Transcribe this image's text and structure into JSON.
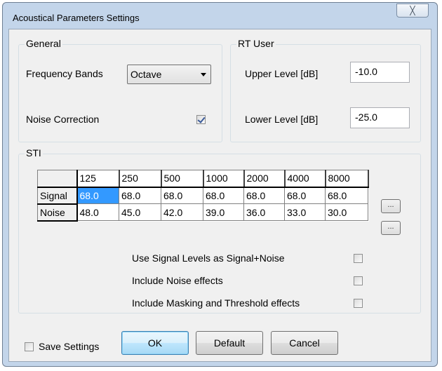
{
  "window": {
    "title": "Acoustical Parameters Settings",
    "close_glyph": "╳"
  },
  "general": {
    "title": "General",
    "frequency_bands_label": "Frequency Bands",
    "frequency_bands_value": "Octave",
    "noise_correction_label": "Noise Correction",
    "noise_correction_checked": true
  },
  "rt_user": {
    "title": "RT User",
    "upper_label": "Upper Level [dB]",
    "upper_value": "-10.0",
    "lower_label": "Lower Level [dB]",
    "lower_value": "-25.0"
  },
  "sti": {
    "title": "STI",
    "columns": [
      "125",
      "250",
      "500",
      "1000",
      "2000",
      "4000",
      "8000"
    ],
    "rows": [
      {
        "label": "Signal",
        "values": [
          "68.0",
          "68.0",
          "68.0",
          "68.0",
          "68.0",
          "68.0",
          "68.0"
        ]
      },
      {
        "label": "Noise",
        "values": [
          "48.0",
          "45.0",
          "42.0",
          "39.0",
          "36.0",
          "33.0",
          "30.0"
        ]
      }
    ],
    "more_button_label": "...",
    "options": [
      {
        "label": "Use Signal Levels as Signal+Noise",
        "checked": false
      },
      {
        "label": "Include Noise effects",
        "checked": false
      },
      {
        "label": "Include Masking and Threshold effects",
        "checked": false
      }
    ]
  },
  "footer": {
    "save_settings_label": "Save Settings",
    "save_settings_checked": false,
    "ok_label": "OK",
    "default_label": "Default",
    "cancel_label": "Cancel"
  }
}
